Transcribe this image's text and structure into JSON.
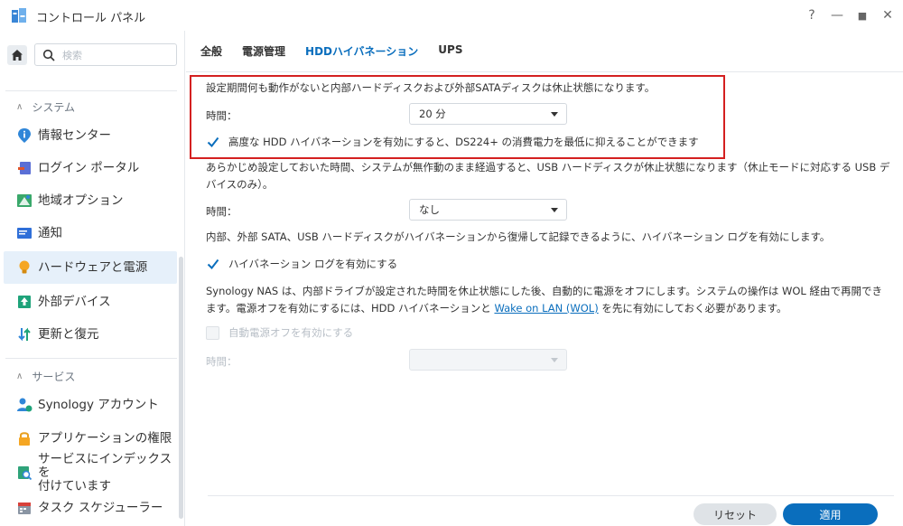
{
  "window": {
    "title": "コントロール パネル",
    "help": "?",
    "minimize": "—",
    "maximize": "■",
    "close": "✕"
  },
  "sidebar": {
    "search_placeholder": "検索",
    "sections": [
      {
        "label": "システム"
      },
      {
        "label": "サービス"
      }
    ],
    "items": [
      {
        "label": "情報センター",
        "icon": "info-icon"
      },
      {
        "label": "ログイン ポータル",
        "icon": "login-portal-icon"
      },
      {
        "label": "地域オプション",
        "icon": "region-icon"
      },
      {
        "label": "通知",
        "icon": "notification-icon"
      },
      {
        "label": "ハードウェアと電源",
        "icon": "bulb-icon",
        "active": true
      },
      {
        "label": "外部デバイス",
        "icon": "external-device-icon"
      },
      {
        "label": "更新と復元",
        "icon": "update-icon"
      },
      {
        "label": "Synology アカウント",
        "icon": "account-icon"
      },
      {
        "label": "アプリケーションの権限",
        "icon": "lock-icon"
      },
      {
        "label": "サービスにインデックスを付けています",
        "label_line1": "サービスにインデックスを",
        "label_line2": "付けています",
        "icon": "index-icon"
      },
      {
        "label": "タスク スケジューラー",
        "icon": "calendar-icon"
      }
    ]
  },
  "tabs": [
    "全般",
    "電源管理",
    "HDDハイバネーション",
    "UPS"
  ],
  "active_tab": "HDDハイバネーション",
  "content": {
    "internal_desc": "設定期間何も動作がないと内部ハードディスクおよび外部SATAディスクは休止状態になります。",
    "internal_time_label": "時間：",
    "internal_time_value": "20 分",
    "advanced_label": "高度な HDD ハイバネーションを有効にすると、DS224+ の消費電力を最低に抑えることができます",
    "advanced_checked": true,
    "usb_desc_line1": "あらかじめ設定しておいた時間、システムが無作動のまま経過すると、USB ハードディスクが休止状態になります（休止モードに対応する USB デ",
    "usb_desc_line2": "バイスのみ）。",
    "usb_time_label": "時間：",
    "usb_time_value": "なし",
    "log_desc": "内部、外部 SATA、USB ハードディスクがハイバネーションから復帰して記録できるように、ハイバネーション ログを有効にします。",
    "log_label": "ハイバネーション ログを有効にする",
    "log_checked": true,
    "poweroff_desc_line1": "Synology NAS は、内部ドライブが設定された時間を休止状態にした後、自動的に電源をオフにします。システムの操作は WOL 経由で再開でき",
    "poweroff_desc_line2a": "ます。電源オフを有効にするには、HDD ハイバネーションと ",
    "poweroff_link": "Wake on LAN (WOL)",
    "poweroff_desc_line2b": " を先に有効にしておく必要があります。",
    "auto_poweroff_label": "自動電源オフを有効にする",
    "auto_poweroff_checked": false,
    "auto_poweroff_time_label": "時間：",
    "auto_poweroff_time_value": ""
  },
  "footer": {
    "reset_label": "リセット",
    "apply_label": "適用"
  },
  "colors": {
    "accent": "#0a6ebd",
    "highlight_box": "#d42020",
    "active_sidebar_bg": "#e6f0fa"
  }
}
